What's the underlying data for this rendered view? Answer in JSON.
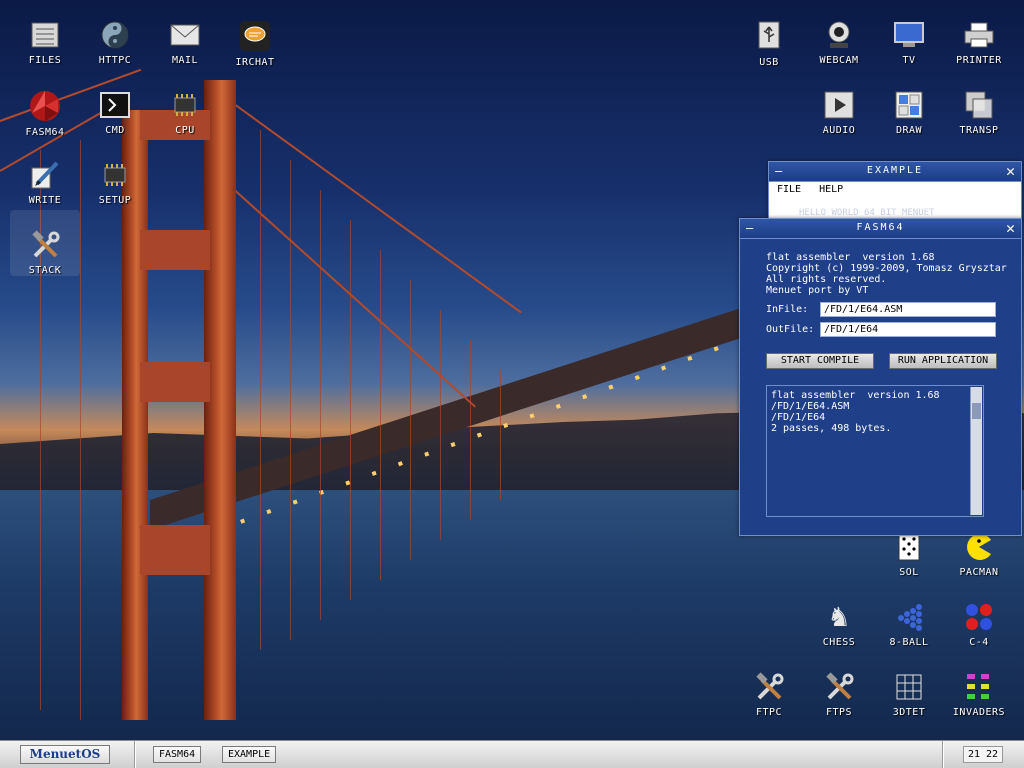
{
  "desktop": {
    "icons": [
      {
        "label": "FILES",
        "icon": "files-icon"
      },
      {
        "label": "HTTPC",
        "icon": "globe-icon"
      },
      {
        "label": "MAIL",
        "icon": "mail-icon"
      },
      {
        "label": "IRCHAT",
        "icon": "chat-icon"
      },
      {
        "label": "FASM64",
        "icon": "fasm-icon"
      },
      {
        "label": "CMD",
        "icon": "terminal-icon"
      },
      {
        "label": "CPU",
        "icon": "chip-icon"
      },
      {
        "label": "WRITE",
        "icon": "pen-icon"
      },
      {
        "label": "SETUP",
        "icon": "setup-chip-icon"
      },
      {
        "label": "STACK",
        "icon": "tools-icon"
      },
      {
        "label": "USB",
        "icon": "usb-icon"
      },
      {
        "label": "WEBCAM",
        "icon": "webcam-icon"
      },
      {
        "label": "TV",
        "icon": "tv-icon"
      },
      {
        "label": "PRINTER",
        "icon": "printer-icon"
      },
      {
        "label": "AUDIO",
        "icon": "play-icon"
      },
      {
        "label": "DRAW",
        "icon": "draw-icon"
      },
      {
        "label": "TRANSP",
        "icon": "transparency-icon"
      },
      {
        "label": "SOL",
        "icon": "card-icon"
      },
      {
        "label": "PACMAN",
        "icon": "pacman-icon"
      },
      {
        "label": "CHESS",
        "icon": "chess-knight-icon"
      },
      {
        "label": "8-BALL",
        "icon": "billiard-icon"
      },
      {
        "label": "C-4",
        "icon": "connect4-icon"
      },
      {
        "label": "FTPC",
        "icon": "tools-icon"
      },
      {
        "label": "FTPS",
        "icon": "tools-icon"
      },
      {
        "label": "3DTET",
        "icon": "grid-icon"
      },
      {
        "label": "INVADERS",
        "icon": "invaders-icon"
      }
    ]
  },
  "example_window": {
    "title": "EXAMPLE",
    "menu": [
      "FILE",
      "HELP"
    ],
    "hidden_text": "HELLO WORLD 64 BIT MENUET"
  },
  "fasm_window": {
    "title": "FASM64",
    "header_lines": "flat assembler  version 1.68\nCopyright (c) 1999-2009, Tomasz Grysztar\nAll rights reserved.\nMenuet port by VT",
    "infile_label": "InFile:",
    "infile_value": "/FD/1/E64.ASM",
    "outfile_label": "OutFile:",
    "outfile_value": "/FD/1/E64",
    "start_compile": "START COMPILE",
    "run_application": "RUN APPLICATION",
    "output": "flat assembler  version 1.68\n/FD/1/E64.ASM\n/FD/1/E64\n2 passes, 498 bytes."
  },
  "taskbar": {
    "start_label": "MenuetOS",
    "tasks": [
      "FASM64",
      "EXAMPLE"
    ],
    "clock": "21 22"
  }
}
